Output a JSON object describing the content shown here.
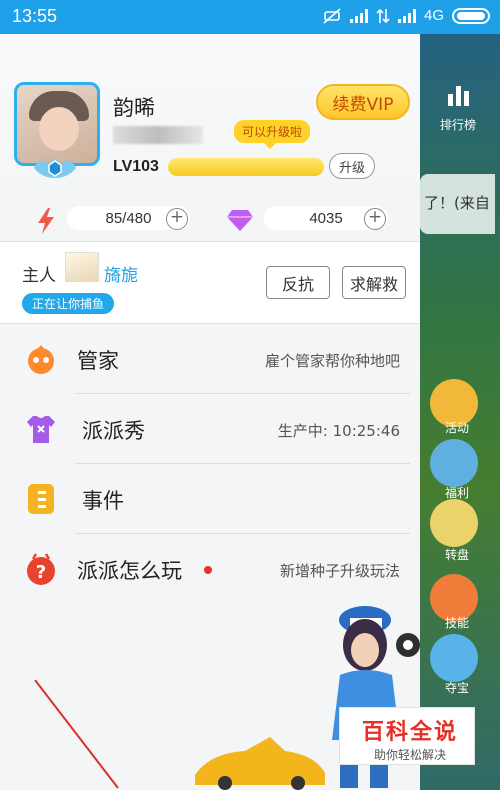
{
  "status_bar": {
    "time": "13:55",
    "network": "4G"
  },
  "background": {
    "rank_label": "排行榜",
    "message_text": "了！(来自",
    "side_labels": [
      "活动",
      "福利",
      "转盘",
      "技能",
      "夺宝"
    ]
  },
  "profile": {
    "name": "韵晞",
    "level": "LV103",
    "level_progress": 1.0,
    "upgrade_tip": "可以升级啦",
    "upgrade_label": "升级",
    "vip_label": "续费VIP"
  },
  "stats": {
    "energy": "85/480",
    "diamonds": "4035"
  },
  "owner": {
    "label": "主人",
    "name": "旖旎",
    "status": "正在让你捕鱼",
    "resist_label": "反抗",
    "plead_label": "求解救"
  },
  "menu": [
    {
      "title": "管家",
      "desc": "雇个管家帮你种地吧",
      "icon": "butler-icon"
    },
    {
      "title": "派派秀",
      "desc": "生产中: 10:25:46",
      "icon": "shirt-icon"
    },
    {
      "title": "事件",
      "desc": "",
      "icon": "event-icon"
    },
    {
      "title": "派派怎么玩",
      "desc": "新增种子升级玩法",
      "icon": "help-icon"
    }
  ],
  "watermark": {
    "title": "百科全说",
    "subtitle": "助你轻松解决"
  },
  "colors": {
    "accent": "#1ea1e8",
    "vip": "#ffc72a",
    "diamond": "#c25bf0",
    "energy": "#ef5a4a"
  }
}
